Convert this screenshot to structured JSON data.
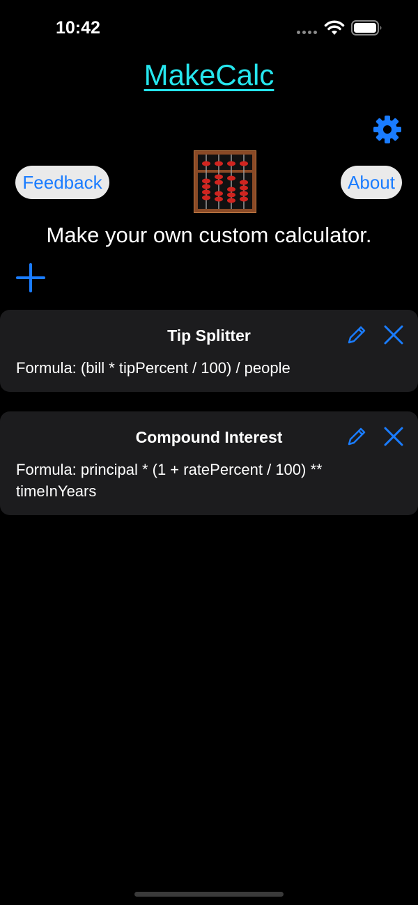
{
  "status_bar": {
    "time": "10:42"
  },
  "header": {
    "title": "MakeCalc",
    "settings_icon": "gear-icon"
  },
  "actions": {
    "feedback_label": "Feedback",
    "about_label": "About",
    "logo_icon": "abacus-logo"
  },
  "main": {
    "subtitle": "Make your own custom calculator.",
    "add_icon": "plus-icon"
  },
  "calculators": [
    {
      "title": "Tip Splitter",
      "formula": "Formula: (bill * tipPercent / 100) / people"
    },
    {
      "title": "Compound Interest",
      "formula": "Formula: principal * (1 + ratePercent / 100) ** timeInYears"
    }
  ],
  "colors": {
    "background": "#000000",
    "title_accent": "#26e6ee",
    "button_blue": "#1a7cff",
    "card_background": "#1c1c1e",
    "pill_background": "#eaeaea"
  }
}
